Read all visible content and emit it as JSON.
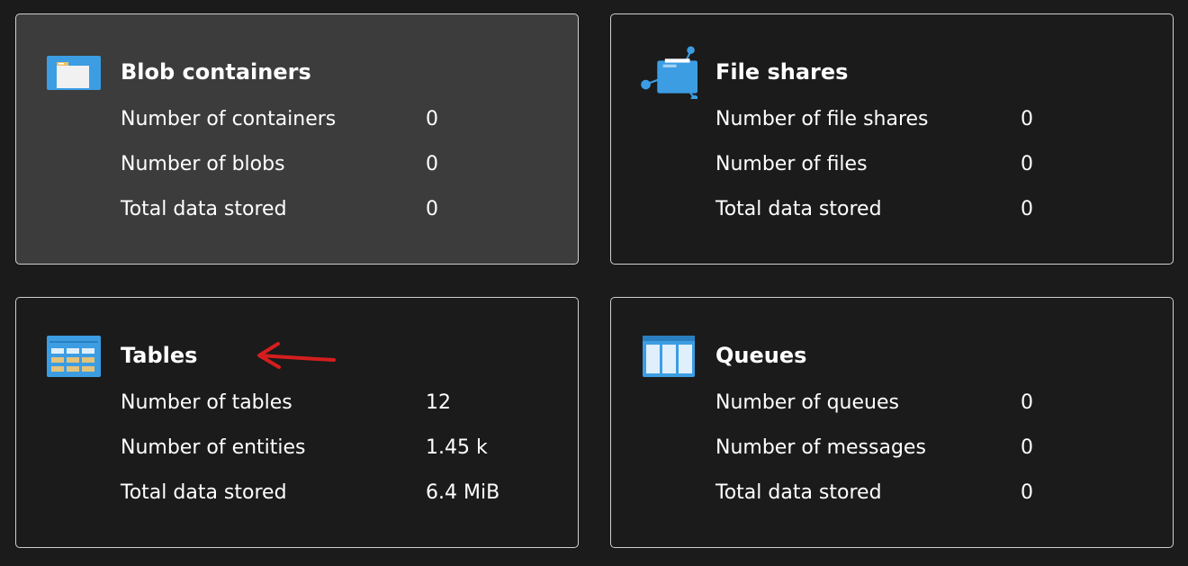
{
  "cards": {
    "blob": {
      "title": "Blob containers",
      "icon": "blob-container-icon",
      "rows": [
        {
          "label": "Number of containers",
          "value": "0"
        },
        {
          "label": "Number of blobs",
          "value": "0"
        },
        {
          "label": "Total data stored",
          "value": "0"
        }
      ]
    },
    "files": {
      "title": "File shares",
      "icon": "file-share-icon",
      "rows": [
        {
          "label": "Number of file shares",
          "value": "0"
        },
        {
          "label": "Number of files",
          "value": "0"
        },
        {
          "label": "Total data stored",
          "value": "0"
        }
      ]
    },
    "tables": {
      "title": "Tables",
      "icon": "table-icon",
      "rows": [
        {
          "label": "Number of tables",
          "value": "12"
        },
        {
          "label": "Number of entities",
          "value": "1.45 k"
        },
        {
          "label": "Total data stored",
          "value": "6.4 MiB"
        }
      ]
    },
    "queues": {
      "title": "Queues",
      "icon": "queue-icon",
      "rows": [
        {
          "label": "Number of queues",
          "value": "0"
        },
        {
          "label": "Number of messages",
          "value": "0"
        },
        {
          "label": "Total data stored",
          "value": "0"
        }
      ]
    }
  },
  "annotation": {
    "icon": "red-arrow-icon",
    "color": "#d41e1e"
  },
  "colors": {
    "background": "#1b1b1b",
    "hover_card": "#3c3c3c",
    "border": "#cfcfcf",
    "azure_blue": "#3c9de3"
  }
}
